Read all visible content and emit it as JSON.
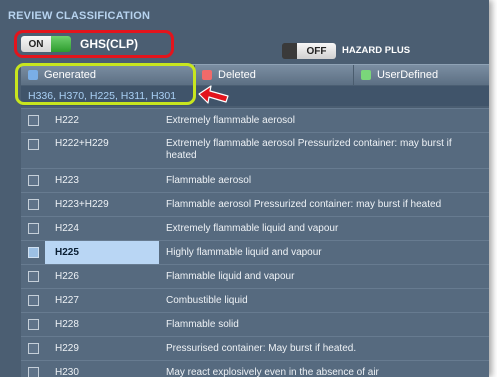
{
  "title": "REVIEW CLASSIFICATION",
  "ghs_toggle": {
    "state": "ON",
    "label": "GHS(CLP)"
  },
  "hazard_plus": {
    "state": "OFF",
    "label": "HAZARD PLUS"
  },
  "columns": [
    {
      "label": "Generated",
      "color": "#7aaee6"
    },
    {
      "label": "Deleted",
      "color": "#ef6a6a"
    },
    {
      "label": "UserDefined",
      "color": "#7ad67a"
    }
  ],
  "generated_codes": "H336, H370, H225, H311, H301",
  "accent_colors": {
    "highlight_red": "#e3141c",
    "highlight_yellow": "#c8e61e"
  },
  "rows": [
    {
      "code": "H222",
      "desc": "Extremely flammable aerosol",
      "selected": false
    },
    {
      "code": "H222+H229",
      "desc": "Extremely flammable aerosol Pressurized container: may burst if heated",
      "selected": false
    },
    {
      "code": "H223",
      "desc": "Flammable aerosol",
      "selected": false
    },
    {
      "code": "H223+H229",
      "desc": "Flammable aerosol Pressurized container: may burst if heated",
      "selected": false
    },
    {
      "code": "H224",
      "desc": "Extremely flammable liquid and vapour",
      "selected": false
    },
    {
      "code": "H225",
      "desc": "Highly flammable liquid and vapour",
      "selected": true
    },
    {
      "code": "H226",
      "desc": "Flammable liquid and vapour",
      "selected": false
    },
    {
      "code": "H227",
      "desc": "Combustible liquid",
      "selected": false
    },
    {
      "code": "H228",
      "desc": "Flammable solid",
      "selected": false
    },
    {
      "code": "H229",
      "desc": "Pressurised container: May burst if heated.",
      "selected": false
    },
    {
      "code": "H230",
      "desc": "May react explosively even in the absence of air",
      "selected": false
    }
  ]
}
